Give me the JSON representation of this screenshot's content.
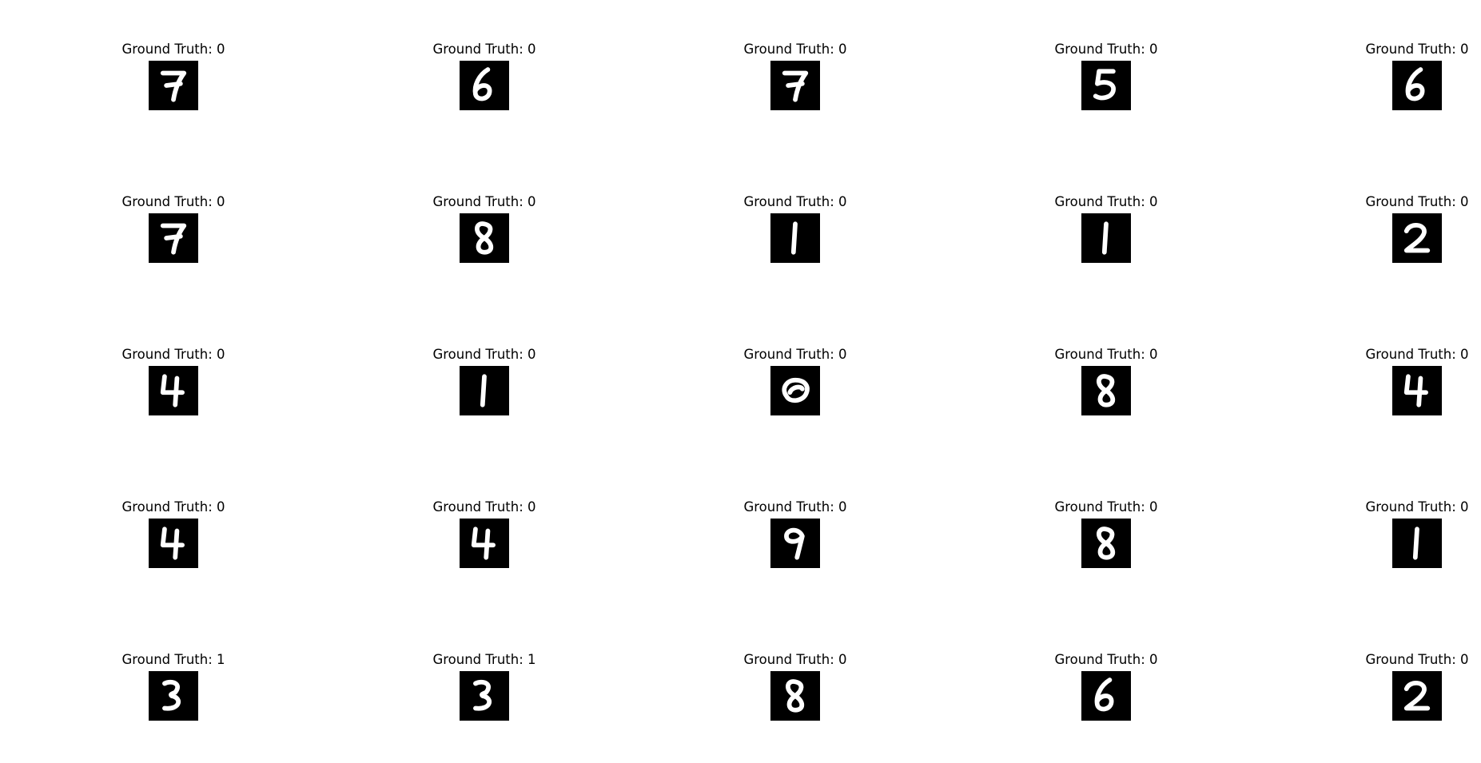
{
  "figure": {
    "cells": [
      {
        "title": "Ground Truth: 0",
        "digit": "7",
        "glyph": "digit-7-image"
      },
      {
        "title": "Ground Truth: 0",
        "digit": "6",
        "glyph": "digit-6-image"
      },
      {
        "title": "Ground Truth: 0",
        "digit": "7",
        "glyph": "digit-7-image"
      },
      {
        "title": "Ground Truth: 0",
        "digit": "5",
        "glyph": "digit-5-image"
      },
      {
        "title": "Ground Truth: 0",
        "digit": "6",
        "glyph": "digit-6-image"
      },
      {
        "title": "Ground Truth: 0",
        "digit": "7",
        "glyph": "digit-7-image"
      },
      {
        "title": "Ground Truth: 0",
        "digit": "8",
        "glyph": "digit-8-image"
      },
      {
        "title": "Ground Truth: 0",
        "digit": "1",
        "glyph": "digit-1-image"
      },
      {
        "title": "Ground Truth: 0",
        "digit": "1",
        "glyph": "digit-1-image"
      },
      {
        "title": "Ground Truth: 0",
        "digit": "2",
        "glyph": "digit-2-image"
      },
      {
        "title": "Ground Truth: 0",
        "digit": "4",
        "glyph": "digit-4-image"
      },
      {
        "title": "Ground Truth: 0",
        "digit": "1",
        "glyph": "digit-1-image"
      },
      {
        "title": "Ground Truth: 0",
        "digit": "0",
        "glyph": "digit-0-image"
      },
      {
        "title": "Ground Truth: 0",
        "digit": "8",
        "glyph": "digit-8-image"
      },
      {
        "title": "Ground Truth: 0",
        "digit": "4",
        "glyph": "digit-4-image"
      },
      {
        "title": "Ground Truth: 0",
        "digit": "4",
        "glyph": "digit-4-image"
      },
      {
        "title": "Ground Truth: 0",
        "digit": "4",
        "glyph": "digit-4-image"
      },
      {
        "title": "Ground Truth: 0",
        "digit": "9",
        "glyph": "digit-9-image"
      },
      {
        "title": "Ground Truth: 0",
        "digit": "8",
        "glyph": "digit-8-image"
      },
      {
        "title": "Ground Truth: 0",
        "digit": "1",
        "glyph": "digit-1-image"
      },
      {
        "title": "Ground Truth: 1",
        "digit": "3",
        "glyph": "digit-3-image"
      },
      {
        "title": "Ground Truth: 1",
        "digit": "3",
        "glyph": "digit-3-image"
      },
      {
        "title": "Ground Truth: 0",
        "digit": "8",
        "glyph": "digit-8-image"
      },
      {
        "title": "Ground Truth: 0",
        "digit": "6",
        "glyph": "digit-6-image"
      },
      {
        "title": "Ground Truth: 0",
        "digit": "2",
        "glyph": "digit-2-image"
      }
    ],
    "colors": {
      "background": "#ffffff",
      "thumb_background": "#000000",
      "digit_stroke": "#ffffff"
    }
  }
}
